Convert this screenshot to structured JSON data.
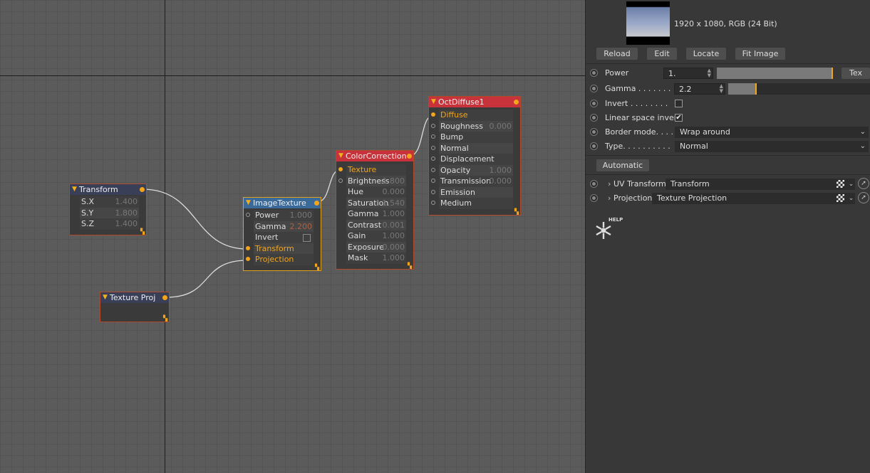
{
  "graph": {
    "nodes": {
      "transform": {
        "title": "Transform",
        "rows": [
          {
            "label": "S.X",
            "value": "1.400"
          },
          {
            "label": "S.Y",
            "value": "1.800"
          },
          {
            "label": "S.Z",
            "value": "1.400"
          }
        ]
      },
      "texture_proj": {
        "title": "Texture Proj"
      },
      "image_texture": {
        "title": "ImageTexture",
        "rows": [
          {
            "label": "Power",
            "value": "1.000"
          },
          {
            "label": "Gamma",
            "value": "2.200"
          },
          {
            "label": "Invert",
            "value": ""
          },
          {
            "label": "Transform",
            "value": ""
          },
          {
            "label": "Projection",
            "value": ""
          }
        ]
      },
      "color_correction": {
        "title": "ColorCorrection",
        "rows": [
          {
            "label": "Texture",
            "value": ""
          },
          {
            "label": "Brightness",
            "value": "1.800"
          },
          {
            "label": "Hue",
            "value": "0.000"
          },
          {
            "label": "Saturation",
            "value": "1.540"
          },
          {
            "label": "Gamma",
            "value": "1.000"
          },
          {
            "label": "Contrast",
            "value": "0.001"
          },
          {
            "label": "Gain",
            "value": "1.000"
          },
          {
            "label": "Exposure",
            "value": "0.000"
          },
          {
            "label": "Mask",
            "value": "1.000"
          }
        ]
      },
      "oct_diffuse": {
        "title": "OctDiffuse1",
        "rows": [
          {
            "label": "Diffuse",
            "value": ""
          },
          {
            "label": "Roughness",
            "value": "0.000"
          },
          {
            "label": "Bump",
            "value": ""
          },
          {
            "label": "Normal",
            "value": ""
          },
          {
            "label": "Displacement",
            "value": ""
          },
          {
            "label": "Opacity",
            "value": "1.000"
          },
          {
            "label": "Transmission",
            "value": "0.000"
          },
          {
            "label": "Emission",
            "value": ""
          },
          {
            "label": "Medium",
            "value": ""
          }
        ]
      }
    }
  },
  "panel": {
    "image_info": "1920 x 1080, RGB (24 Bit)",
    "buttons": {
      "reload": "Reload",
      "edit": "Edit",
      "locate": "Locate",
      "fit_image": "Fit Image",
      "automatic": "Automatic"
    },
    "power": {
      "label": "Power",
      "value": "1.",
      "tex": "Tex",
      "level": 1.0
    },
    "gamma": {
      "label": "Gamma . . . . . . .",
      "value": "2.2",
      "level": 0.2
    },
    "invert": {
      "label": "Invert . . . . . . . .",
      "checked": false
    },
    "linear_space_invert": {
      "label": "Linear space invert",
      "checked": true,
      "check_glyph": "✔"
    },
    "border_mode": {
      "label": "Border mode. . . .",
      "value": "Wrap around"
    },
    "type": {
      "label": "Type. . . . . . . . . .",
      "value": "Normal"
    },
    "uv_transform": {
      "label": "UV Transform",
      "value": "Transform"
    },
    "projection": {
      "label": "Projection",
      "value": "Texture Projection"
    },
    "help_label": "HELP"
  },
  "accent_color": "#f2a51a"
}
